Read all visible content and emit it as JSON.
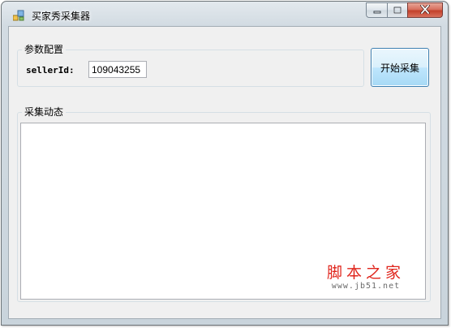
{
  "window": {
    "title": "买家秀采集器"
  },
  "caption_buttons": {
    "minimize_icon": "minimize-icon",
    "maximize_icon": "maximize-icon",
    "close_icon": "close-icon",
    "close_color": "#c3402a"
  },
  "params": {
    "legend": "参数配置",
    "seller_label": "sellerId:",
    "seller_value": "109043255"
  },
  "start_button": {
    "label": "开始采集",
    "accent": "#3c7fb1"
  },
  "log": {
    "legend": "采集动态",
    "content": ""
  },
  "watermark": {
    "text": "脚本之家",
    "url": "www.jb51.net",
    "color": "#e0251c"
  }
}
